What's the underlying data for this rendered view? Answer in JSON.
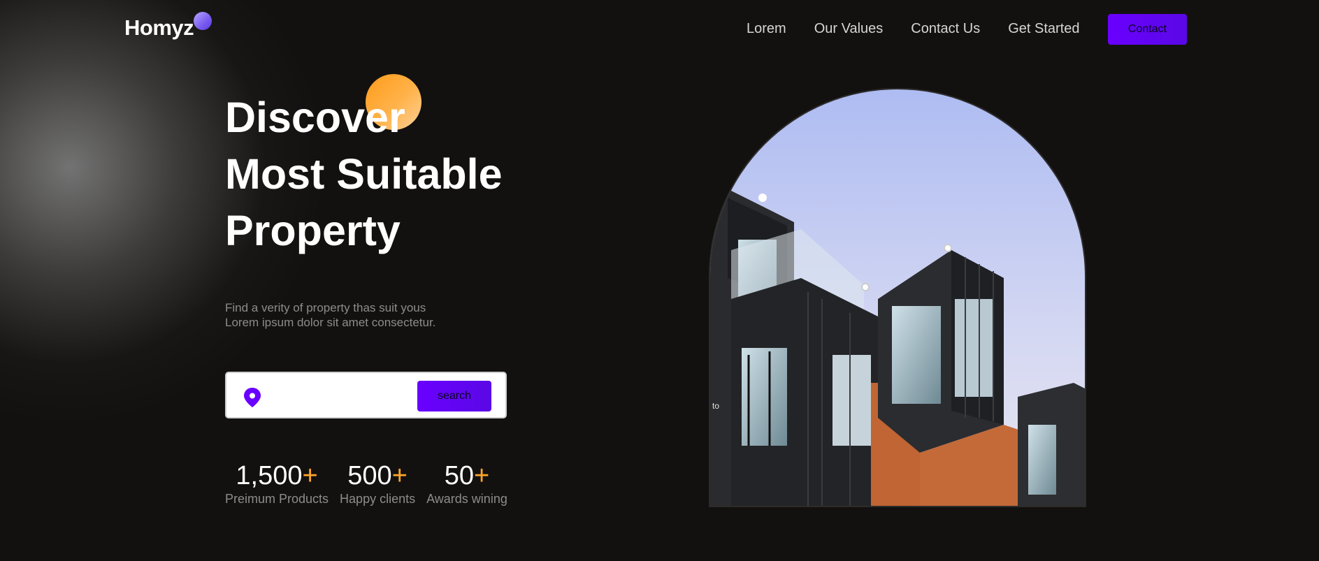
{
  "header": {
    "logo": "Homyz",
    "nav": [
      "Lorem",
      "Our Values",
      "Contact Us",
      "Get Started"
    ],
    "contact_label": "Contact"
  },
  "hero": {
    "title_lines": [
      "Discover",
      "Most Suitable",
      "Property"
    ],
    "subtitle_lines": [
      "Find a verity of property thas suit yous",
      "Lorem ipsum dolor sit amet consectetur."
    ],
    "search": {
      "icon": "location-pin-icon",
      "placeholder": "",
      "button_label": "search"
    },
    "stats": [
      {
        "number": "1,500",
        "suffix": "+",
        "label": "Preimum Products"
      },
      {
        "number": "500",
        "suffix": "+",
        "label": "Happy clients"
      },
      {
        "number": "50",
        "suffix": "+",
        "label": "Awards wining"
      }
    ],
    "image_alt_fragment": "to"
  },
  "colors": {
    "background": "#131110",
    "accent_purple": "#6a00ff",
    "accent_orange": "#ffa629",
    "text_muted": "#8e8b89"
  }
}
